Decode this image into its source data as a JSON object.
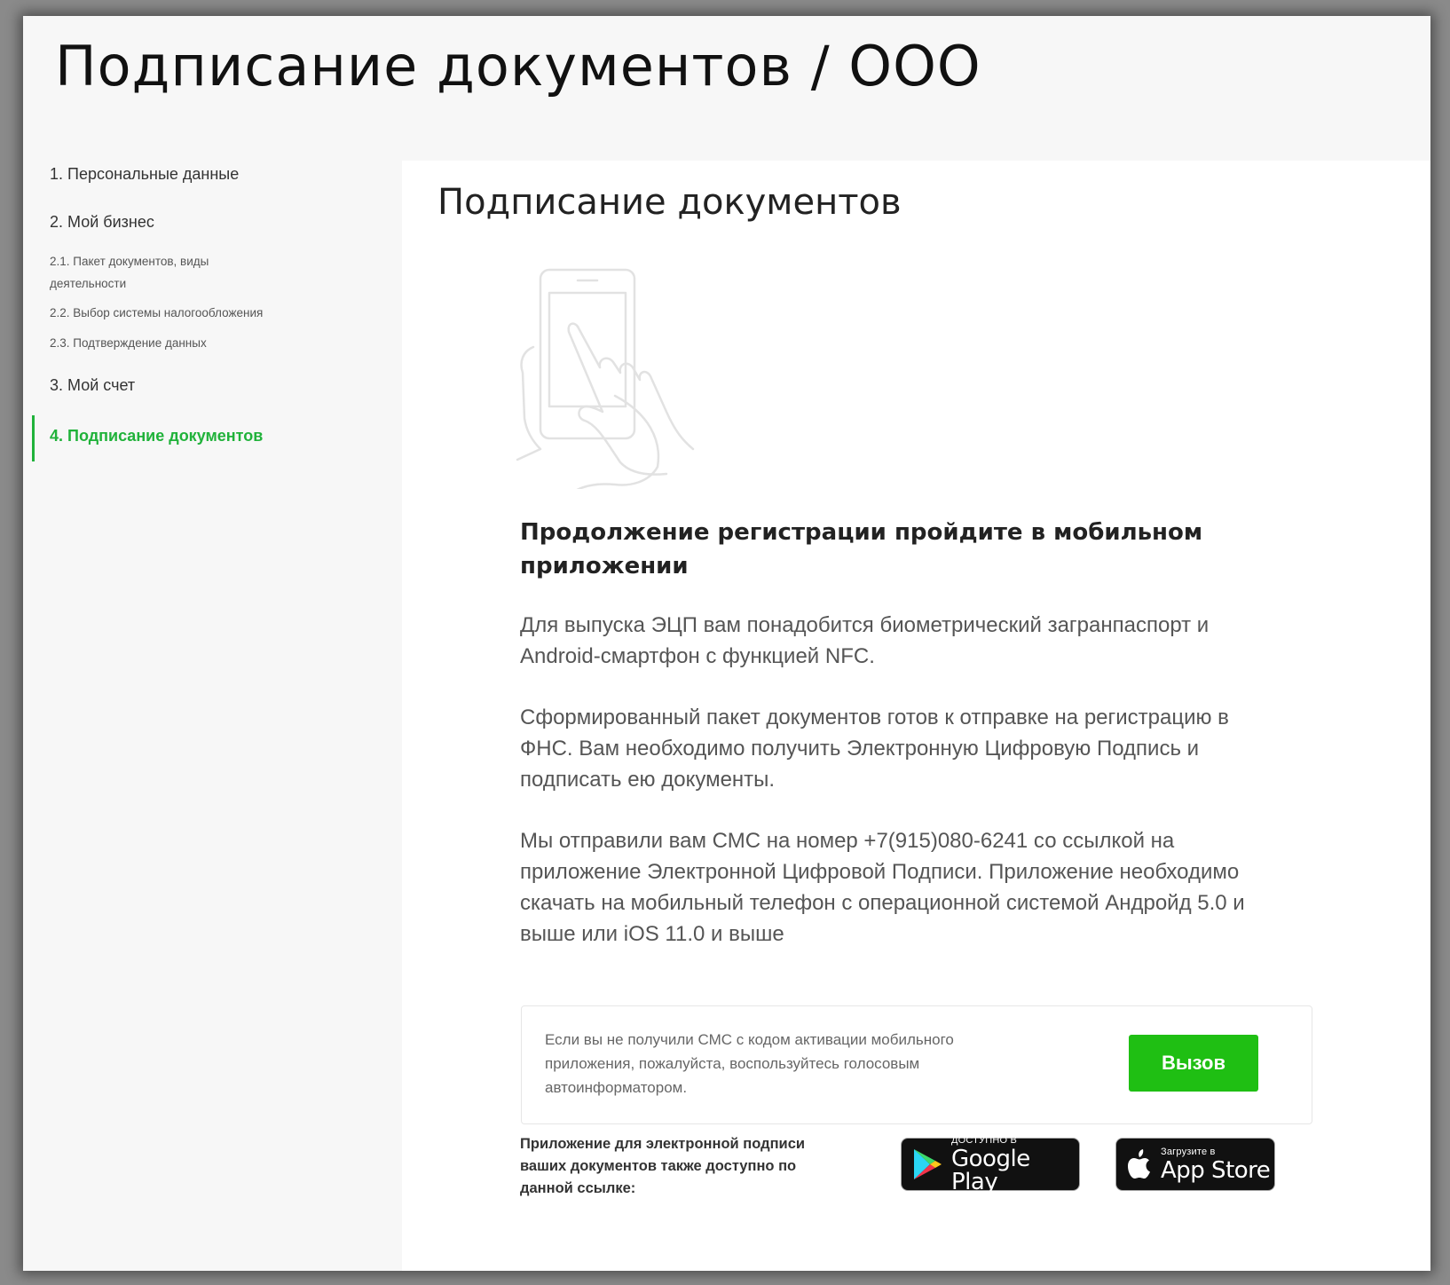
{
  "page": {
    "title": "Подписание документов / ООО"
  },
  "sidebar": {
    "items": [
      {
        "label": "1. Персональные данные"
      },
      {
        "label": "2. Мой бизнес"
      },
      {
        "label": "2.1. Пакет документов, виды деятельности"
      },
      {
        "label": "2.2. Выбор системы налогообложения"
      },
      {
        "label": "2.3. Подтверждение данных"
      },
      {
        "label": "3. Мой счет"
      },
      {
        "label": "4. Подписание документов",
        "active": true
      }
    ]
  },
  "main": {
    "title": "Подписание документов",
    "illustration_icon": "hand-holding-phone-icon",
    "subheading": "Продолжение регистрации пройдите в мобильном приложении",
    "paragraphs": [
      "Для выпуска ЭЦП вам понадобится биометрический загранпаспорт и Android-смартфон с функцией NFC.",
      "Сформированный пакет документов готов к отправке на регистрацию в ФНС. Вам необходимо получить Электронную Цифровую Подпись и подписать ею документы.",
      "Мы отправили вам СМС на номер +7(915)080-6241 со ссылкой на приложение Электронной Цифровой Подписи. Приложение необходимо скачать на мобильный телефон с операционной системой Андройд 5.0 и выше или iOS 11.0 и выше"
    ],
    "sms_box": {
      "text": "Если вы не получили СМС с кодом активации мобильного приложения, пожалуйста, воспользуйтесь голосовым автоинформатором.",
      "button_label": "Вызов"
    },
    "store_note": "Приложение для электронной подписи ваших документов также доступно по данной ссылке:",
    "google_play": {
      "small": "ДОСТУПНО В",
      "big": "Google Play",
      "icon": "google-play-icon"
    },
    "app_store": {
      "small": "Загрузите в",
      "big": "App Store",
      "icon": "apple-icon"
    }
  },
  "colors": {
    "accent": "#20b23a",
    "button": "#1fbf13",
    "text": "#222222",
    "muted": "#555555",
    "background": "#f7f7f7",
    "card": "#ffffff"
  }
}
